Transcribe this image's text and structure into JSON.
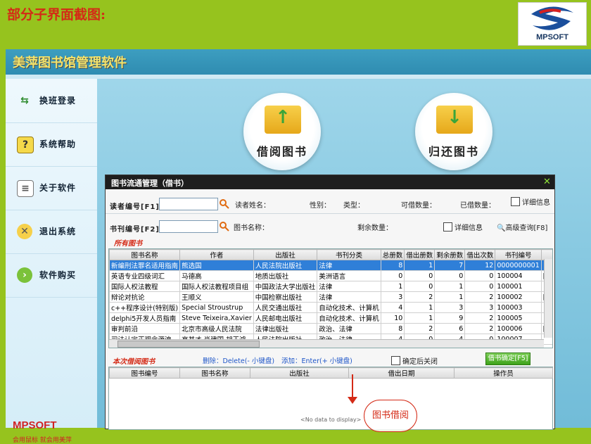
{
  "caption": "部分子界面截图:",
  "logo": {
    "text": "MPSOFT"
  },
  "app": {
    "title": "美萍图书馆管理软件",
    "sidebar": [
      {
        "label": "换班登录",
        "icon": "swap-arrows-icon"
      },
      {
        "label": "系统帮助",
        "icon": "help-icon"
      },
      {
        "label": "关于软件",
        "icon": "document-icon"
      },
      {
        "label": "退出系统",
        "icon": "exit-icon"
      },
      {
        "label": "软件购买",
        "icon": "purchase-icon"
      }
    ],
    "brand": "MPSOFT",
    "brand_slogan": "会用鼠标  就会用美萍",
    "borrow_label": "借阅图书",
    "return_label": "归还图书"
  },
  "dialog": {
    "title": "图书流通管理（借书）",
    "reader_no_label": "读者编号[F1]:",
    "reader_no_value": "",
    "reader_name_label": "读者姓名：",
    "gender_label": "性别：",
    "type_label": "类型：",
    "borrowable_label": "可借数量：",
    "borrowed_label": "已借数量：",
    "detail_label": "详细信息",
    "book_no_label": "书刊编号[F2]:",
    "book_no_value": "",
    "book_name_label": "图书名称：",
    "remain_label": "剩余数量：",
    "detail2_label": "详细信息",
    "adv_search_label": "高级查询[F8]",
    "all_books_title": "所有图书",
    "columns": [
      "图书名称",
      "作者",
      "出版社",
      "书刊分类",
      "总册数",
      "借出册数",
      "剩余册数",
      "借出次数",
      "书刊编号",
      ""
    ],
    "rows": [
      [
        "新编刑法罪名适用指南",
        "熊选国",
        "人民法院出版社",
        "法律",
        "8",
        "1",
        "7",
        "12",
        "0000000001",
        ""
      ],
      [
        "英语专业四级词汇",
        "马德高",
        "地质出版社",
        "美洲语言",
        "0",
        "0",
        "0",
        "0",
        "100004",
        "附海报一张"
      ],
      [
        "国际人权法教程",
        "国际人权法教程项目组",
        "中国政法大学出版社",
        "法律",
        "1",
        "0",
        "1",
        "0",
        "100001",
        ""
      ],
      [
        "辩论对抗论",
        "王顺义",
        "中国检察出版社",
        "法律",
        "3",
        "2",
        "1",
        "2",
        "100002",
        "附光盘一张"
      ],
      [
        "c++程序设计(特别版)",
        "Special Stroustrup",
        "人民交通出版社",
        "自动化技术、计算机",
        "4",
        "1",
        "3",
        "3",
        "100003",
        ""
      ],
      [
        "delphi5开发人员指南",
        "Steve Teixeira,Xavier",
        "人民邮电出版社",
        "自动化技术、计算机",
        "10",
        "1",
        "9",
        "2",
        "100005",
        ""
      ],
      [
        "审判前沿",
        "北京市高级人民法院",
        "法律出版社",
        "政治、法律",
        "8",
        "2",
        "6",
        "2",
        "100006",
        "附光盘一张"
      ],
      [
        "司法认定正观念源流",
        "高其才 肖建国 胡玉鸿",
        "人民法院出版社",
        "政治、法律",
        "4",
        "0",
        "4",
        "0",
        "100007",
        ""
      ]
    ],
    "current_borrow_title": "本次借阅图书",
    "delete_hint": "删除：Delete(- 小键盘)",
    "add_hint": "添加：Enter(+ 小键盘)",
    "close_after_label": "确定后关闭",
    "confirm_label": "借书确定[F5]",
    "columns2": [
      "图书编号",
      "图书名称",
      "出版社",
      "借出日期",
      "操作员"
    ],
    "no_data": "<No data to display>",
    "callout": "图书借阅"
  }
}
